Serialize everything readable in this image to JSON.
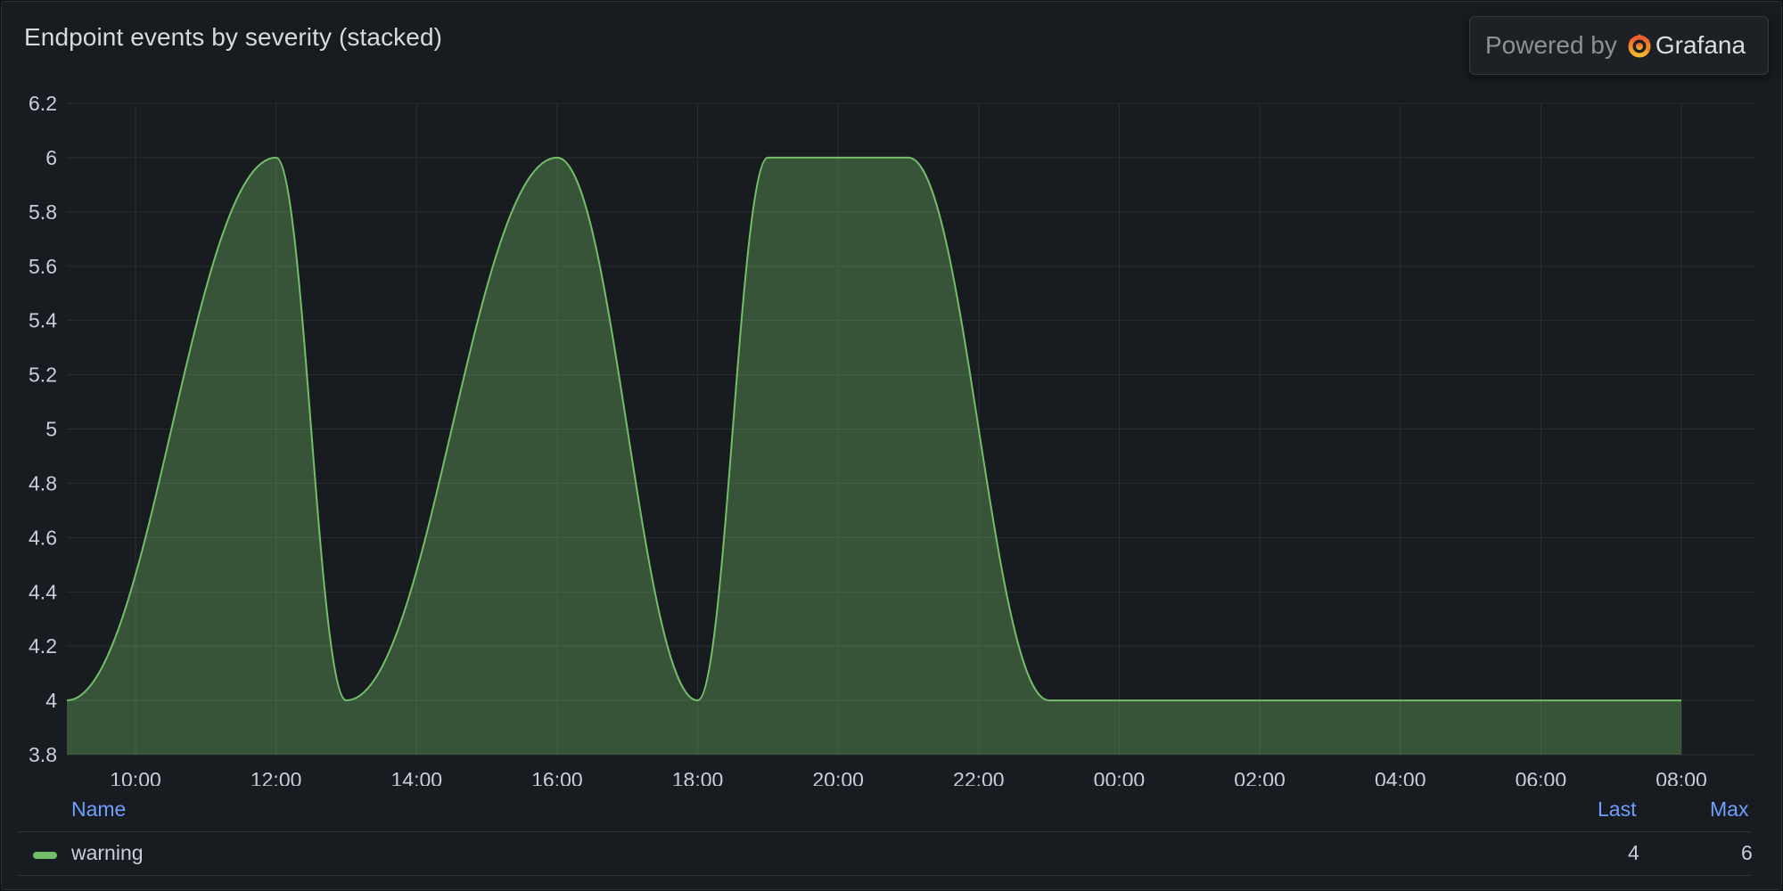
{
  "panel": {
    "title": "Endpoint events by severity (stacked)",
    "powered_by": "Powered by",
    "brand": "Grafana",
    "brand_icon": "grafana-logo-icon"
  },
  "chart_data": {
    "type": "area",
    "stacked": true,
    "ylim": [
      3.8,
      6.2
    ],
    "yticks": [
      "6.2",
      "6",
      "5.8",
      "5.6",
      "5.4",
      "5.2",
      "5",
      "4.8",
      "4.6",
      "4.4",
      "4.2",
      "4",
      "3.8"
    ],
    "xticks": [
      "10:00",
      "12:00",
      "14:00",
      "16:00",
      "18:00",
      "20:00",
      "22:00",
      "00:00",
      "02:00",
      "04:00",
      "06:00",
      "08:00"
    ],
    "grid": true,
    "series": [
      {
        "name": "warning",
        "color": "#73bf69",
        "x": [
          "09:00",
          "12:00",
          "13:00",
          "16:00",
          "18:00",
          "19:00",
          "21:00",
          "23:00",
          "08:00"
        ],
        "values": [
          4,
          6,
          4,
          6,
          4,
          6,
          6,
          4,
          4
        ]
      }
    ]
  },
  "legend": {
    "col_name": "Name",
    "col_last": "Last",
    "col_max": "Max",
    "rows": [
      {
        "name": "warning",
        "last": "4",
        "max": "6"
      }
    ]
  }
}
